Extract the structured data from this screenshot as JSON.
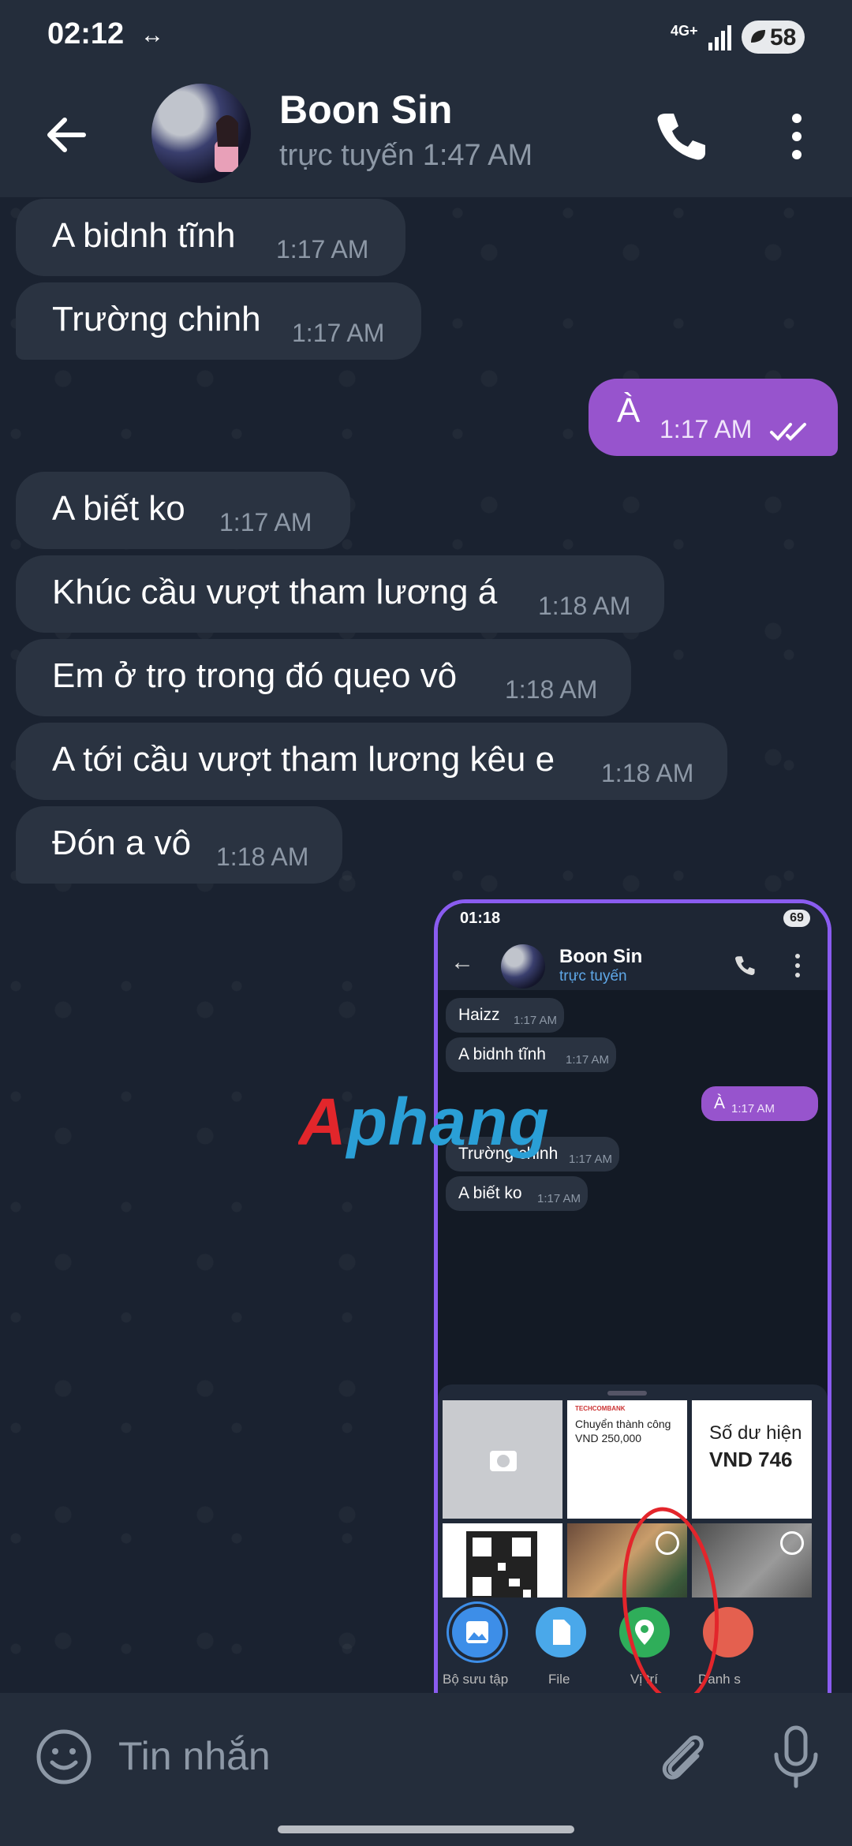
{
  "status_bar": {
    "time": "02:12",
    "arrows": "↔",
    "network": "4G+",
    "battery": "58"
  },
  "header": {
    "title": "Boon Sin",
    "subtitle": "trực tuyến 1:47 AM"
  },
  "messages": [
    {
      "text": "A bidnh tĩnh",
      "time": "1:17 AM",
      "direction": "in"
    },
    {
      "text": "Trường chinh",
      "time": "1:17 AM",
      "direction": "in"
    },
    {
      "text": "À",
      "time": "1:17 AM",
      "direction": "out",
      "read": true
    },
    {
      "text": "A biết ko",
      "time": "1:17 AM",
      "direction": "in"
    },
    {
      "text": "Khúc cầu vượt tham lương á",
      "time": "1:18 AM",
      "direction": "in"
    },
    {
      "text": "Em ở trọ trong đó quẹo vô",
      "time": "1:18 AM",
      "direction": "in"
    },
    {
      "text": "A tới cầu vượt tham lương kêu e",
      "time": "1:18 AM",
      "direction": "in"
    },
    {
      "text": "Đón a vô",
      "time": "1:18 AM",
      "direction": "in"
    }
  ],
  "watermark": "Aphang",
  "screenshot_image": {
    "status_time": "01:18",
    "battery": "69",
    "title": "Boon Sin",
    "subtitle": "trực tuyến",
    "messages": [
      {
        "text": "Haizz",
        "time": "1:17 AM",
        "direction": "in"
      },
      {
        "text": "A bidnh tĩnh",
        "time": "1:17 AM",
        "direction": "in"
      },
      {
        "text": "À",
        "time": "1:17 AM",
        "direction": "out"
      },
      {
        "text": "Trường chinh",
        "time": "1:17 AM",
        "direction": "in"
      },
      {
        "text": "A biết ko",
        "time": "1:17 AM",
        "direction": "in"
      }
    ],
    "gallery": {
      "doc_tile": {
        "bank": "TECHCOMBANK",
        "line1": "Chuyển thành công",
        "line2": "VND 250,000"
      },
      "balance_tile": {
        "line1": "Số dư hiện",
        "line2": "VND 746"
      }
    },
    "attach_buttons": [
      {
        "label": "Bộ sưu tập",
        "color": "#3d8ee8"
      },
      {
        "label": "File",
        "color": "#4aa8ea"
      },
      {
        "label": "Vị trí",
        "color": "#2fae5a"
      },
      {
        "label": "Danh s",
        "color": "#e4604f"
      }
    ]
  },
  "composer": {
    "placeholder": "Tin nhắn"
  },
  "colors": {
    "accent_out": "#9754cd",
    "bubble_in": "#2a3341",
    "bar": "#242d3b",
    "background": "#1a2230",
    "highlight": "#e3252b"
  }
}
